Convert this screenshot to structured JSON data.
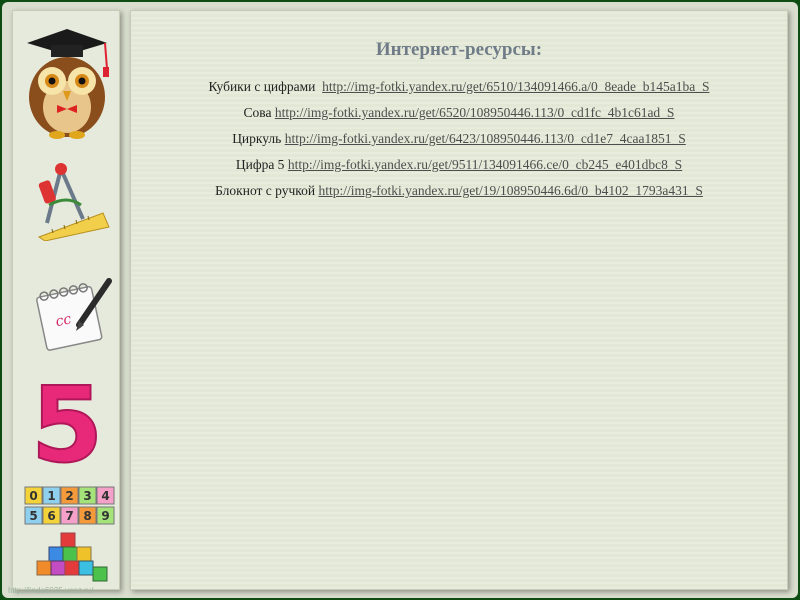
{
  "page": {
    "title": "Интернет-ресурсы:",
    "footer_url": "http://linda6035.ucoz.ru/"
  },
  "resources": [
    {
      "label": "Кубики с цифрами",
      "url": "http://img-fotki.yandex.ru/get/6510/134091466.a/0_8eade_b145a1ba_S"
    },
    {
      "label": "Сова",
      "url": "http://img-fotki.yandex.ru/get/6520/108950446.113/0_cd1fc_4b1c61ad_S"
    },
    {
      "label": "Циркуль",
      "url": "http://img-fotki.yandex.ru/get/6423/108950446.113/0_cd1e7_4caa1851_S"
    },
    {
      "label": "Цифра 5",
      "url": "http://img-fotki.yandex.ru/get/9511/134091466.ce/0_cb245_e401dbc8_S"
    },
    {
      "label": "Блокнот с ручкой",
      "url": "http://img-fotki.yandex.ru/get/19/108950446.6d/0_b4102_1793a431_S"
    }
  ],
  "sidebar": {
    "digit_five": "5",
    "cube_digits_top": [
      "0",
      "1",
      "2",
      "3",
      "4"
    ],
    "cube_digits_bottom": [
      "5",
      "6",
      "7",
      "8",
      "9"
    ],
    "notepad_text": "сс"
  },
  "icons": [
    "owl-icon",
    "compass-ruler-icon",
    "notepad-pen-icon",
    "number-five-icon",
    "number-cubes-icon"
  ],
  "colors": {
    "background": "#0d4d12",
    "panel": "#e3e8d6",
    "title": "#6f7c88",
    "digit_five": "#e8297a"
  }
}
